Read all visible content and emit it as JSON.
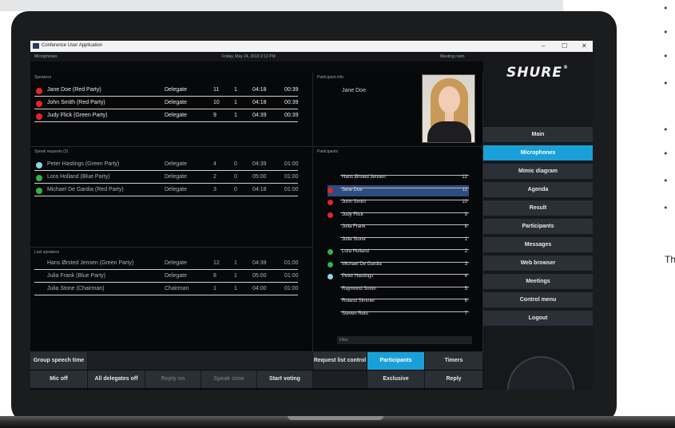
{
  "window": {
    "title": "Conference User Application",
    "controls": {
      "minimize": "–",
      "maximize": "☐",
      "close": "✕"
    }
  },
  "top_strip": {
    "left": "Microphones",
    "center": "Friday, May 24, 2019 2:12 PM",
    "right": "Meeting room"
  },
  "speakers": {
    "heading": "Speakers",
    "rows": [
      {
        "name": "Jane Doe (Red Party)",
        "role": "Delegate",
        "a": "11",
        "b": "1",
        "t1": "04:18",
        "t2": "00:39",
        "dot": "#e0262a"
      },
      {
        "name": "John Smith (Red Party)",
        "role": "Delegate",
        "a": "10",
        "b": "1",
        "t1": "04:18",
        "t2": "00:39",
        "dot": "#e0262a"
      },
      {
        "name": "Judy Flick (Green Party)",
        "role": "Delegate",
        "a": "9",
        "b": "1",
        "t1": "04:39",
        "t2": "00:39",
        "dot": "#e0262a"
      }
    ]
  },
  "participant_info": {
    "heading": "Participant info",
    "name": "Jane Doe"
  },
  "speak_requests": {
    "heading": "Speak requests (3)",
    "rows": [
      {
        "name": "Peter Hastings (Green Party)",
        "role": "Delegate",
        "a": "4",
        "b": "0",
        "t1": "04:39",
        "t2": "01:00",
        "dot": "#8fd3ec"
      },
      {
        "name": "Lora Holland (Blue Party)",
        "role": "Delegate",
        "a": "2",
        "b": "0",
        "t1": "05:00",
        "t2": "01:00",
        "dot": "#2fb34a"
      },
      {
        "name": "Michael De Gardia (Red Party)",
        "role": "Delegate",
        "a": "3",
        "b": "0",
        "t1": "04:18",
        "t2": "01:00",
        "dot": "#2fb34a"
      }
    ]
  },
  "last_speakers": {
    "heading": "Last speakers",
    "rows": [
      {
        "name": "Hans Ørsted Jensen (Green Party)",
        "role": "Delegate",
        "a": "12",
        "b": "1",
        "t1": "04:39",
        "t2": "01:00"
      },
      {
        "name": "Julia Frank (Blue Party)",
        "role": "Delegate",
        "a": "8",
        "b": "1",
        "t1": "05:00",
        "t2": "01:00"
      },
      {
        "name": "Julia Stone (Chairman)",
        "role": "Chairman",
        "a": "1",
        "b": "1",
        "t1": "04:00",
        "t2": "01:00"
      }
    ]
  },
  "participants": {
    "heading": "Participants",
    "filter_placeholder": "Filter",
    "rows": [
      {
        "name": "Hans Ørsted Jensen",
        "num": "12",
        "dot": ""
      },
      {
        "name": "Jane Doe",
        "num": "11",
        "dot": "#e0262a",
        "selected": true
      },
      {
        "name": "John Smith",
        "num": "10",
        "dot": "#e0262a"
      },
      {
        "name": "Judy Flick",
        "num": "9",
        "dot": "#e0262a"
      },
      {
        "name": "Julia Frank",
        "num": "8",
        "dot": ""
      },
      {
        "name": "Julia Stone",
        "num": "1",
        "dot": ""
      },
      {
        "name": "Lora Holland",
        "num": "2",
        "dot": "#2fb34a"
      },
      {
        "name": "Michael De Gardia",
        "num": "3",
        "dot": "#2fb34a"
      },
      {
        "name": "Peter Hastings",
        "num": "4",
        "dot": "#8fd3ec"
      },
      {
        "name": "Raymond Smith",
        "num": "5",
        "dot": ""
      },
      {
        "name": "Roland Simmer",
        "num": "6",
        "dot": ""
      },
      {
        "name": "Steven Reid",
        "num": "7",
        "dot": ""
      }
    ]
  },
  "bottom_bar": {
    "group_speech_time": "Group speech time",
    "request_list_control": "Request list control",
    "participants_tab": "Participants",
    "timers_tab": "Timers",
    "mic_off": "Mic off",
    "all_delegates_off": "All delegates off",
    "reply_on": "Reply on",
    "speak slow": "",
    "speak_slow": "Speak slow",
    "start_voting": "Start voting",
    "exclusive": "Exclusive",
    "reply": "Reply"
  },
  "sidebar": {
    "logo": "SHURE",
    "logo_mark": "®",
    "items": [
      {
        "label": "Main"
      },
      {
        "label": "Microphones",
        "active": true
      },
      {
        "label": "Mimic diagram"
      },
      {
        "label": "Agenda"
      },
      {
        "label": "Result"
      },
      {
        "label": "Participants"
      },
      {
        "label": "Messages"
      },
      {
        "label": "Web browser"
      },
      {
        "label": "Meetings"
      },
      {
        "label": "Control menu"
      },
      {
        "label": "Logout"
      }
    ]
  },
  "page_side": {
    "fragment": "Th",
    "bullet": "•"
  },
  "colors": {
    "accent": "#1aa0d8",
    "red": "#e0262a",
    "green": "#2fb34a",
    "light_blue": "#8fd3ec",
    "selected_row": "#2e4c80"
  }
}
